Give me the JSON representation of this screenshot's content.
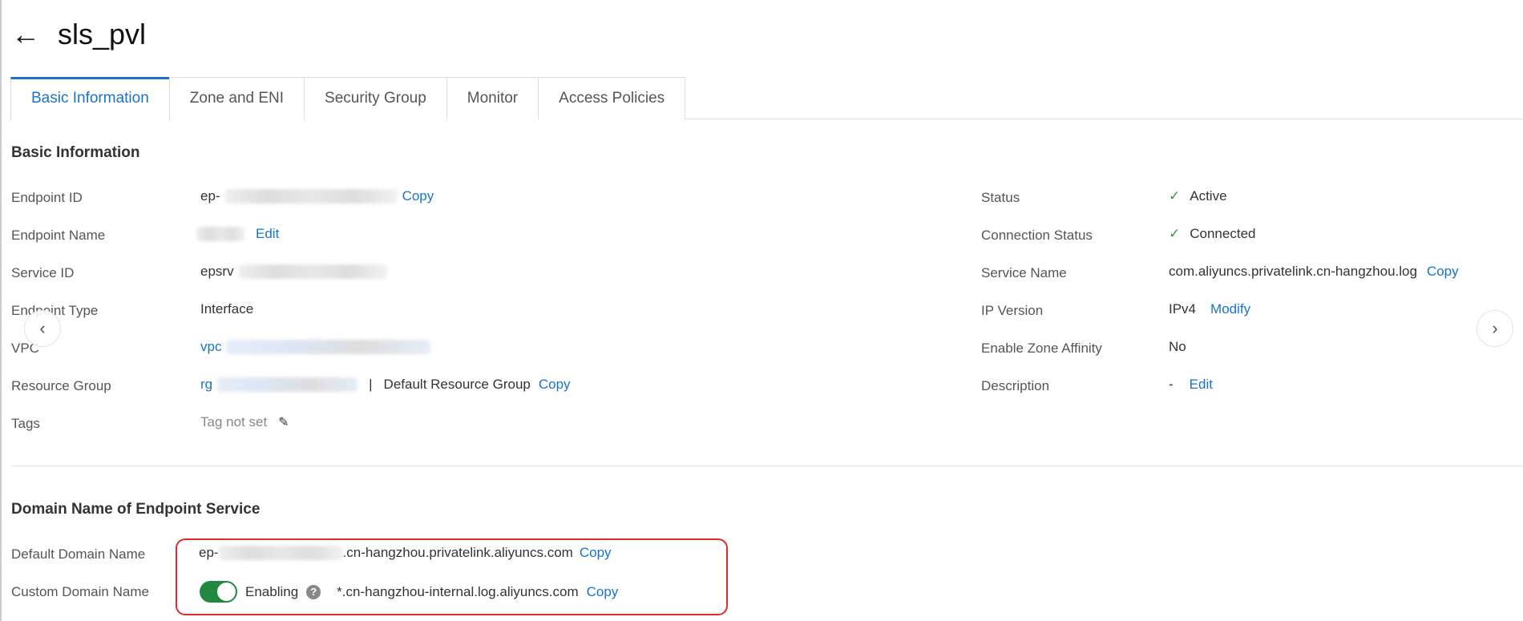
{
  "header": {
    "back_icon": "arrow-left-icon",
    "title": "sls_pvl"
  },
  "tabs": [
    {
      "label": "Basic Information",
      "active": true
    },
    {
      "label": "Zone and ENI"
    },
    {
      "label": "Security Group"
    },
    {
      "label": "Monitor"
    },
    {
      "label": "Access Policies"
    }
  ],
  "basic": {
    "heading": "Basic Information",
    "endpoint_id": {
      "label": "Endpoint ID",
      "value_prefix": "ep-",
      "action": "Copy"
    },
    "endpoint_name": {
      "label": "Endpoint Name",
      "action": "Edit"
    },
    "service_id": {
      "label": "Service ID",
      "value_prefix": "epsrv"
    },
    "endpoint_type": {
      "label": "Endpoint Type",
      "value": "Interface"
    },
    "vpc": {
      "label": "VPC",
      "value_prefix": "vpc"
    },
    "resource_group": {
      "label": "Resource Group",
      "value_prefix": "rg",
      "separator": "|",
      "name": "Default Resource Group",
      "action": "Copy"
    },
    "tags": {
      "label": "Tags",
      "value": "Tag not set"
    },
    "status": {
      "label": "Status",
      "value": "Active"
    },
    "connection_status": {
      "label": "Connection Status",
      "value": "Connected"
    },
    "service_name": {
      "label": "Service Name",
      "value": "com.aliyuncs.privatelink.cn-hangzhou.log",
      "action": "Copy"
    },
    "ip_version": {
      "label": "IP Version",
      "value": "IPv4",
      "action": "Modify"
    },
    "zone_affinity": {
      "label": "Enable Zone Affinity",
      "value": "No"
    },
    "description": {
      "label": "Description",
      "value": "-",
      "action": "Edit"
    }
  },
  "domain": {
    "heading": "Domain Name of Endpoint Service",
    "default": {
      "label": "Default Domain Name",
      "value_prefix": "ep-",
      "value_suffix": ".cn-hangzhou.privatelink.aliyuncs.com",
      "action": "Copy"
    },
    "custom": {
      "label": "Custom Domain Name",
      "toggle_on": true,
      "state": "Enabling",
      "value": "*.cn-hangzhou-internal.log.aliyuncs.com",
      "action": "Copy"
    }
  },
  "colors": {
    "accent": "#1a73c8",
    "success": "#21893f",
    "highlight": "#e02b2b"
  }
}
